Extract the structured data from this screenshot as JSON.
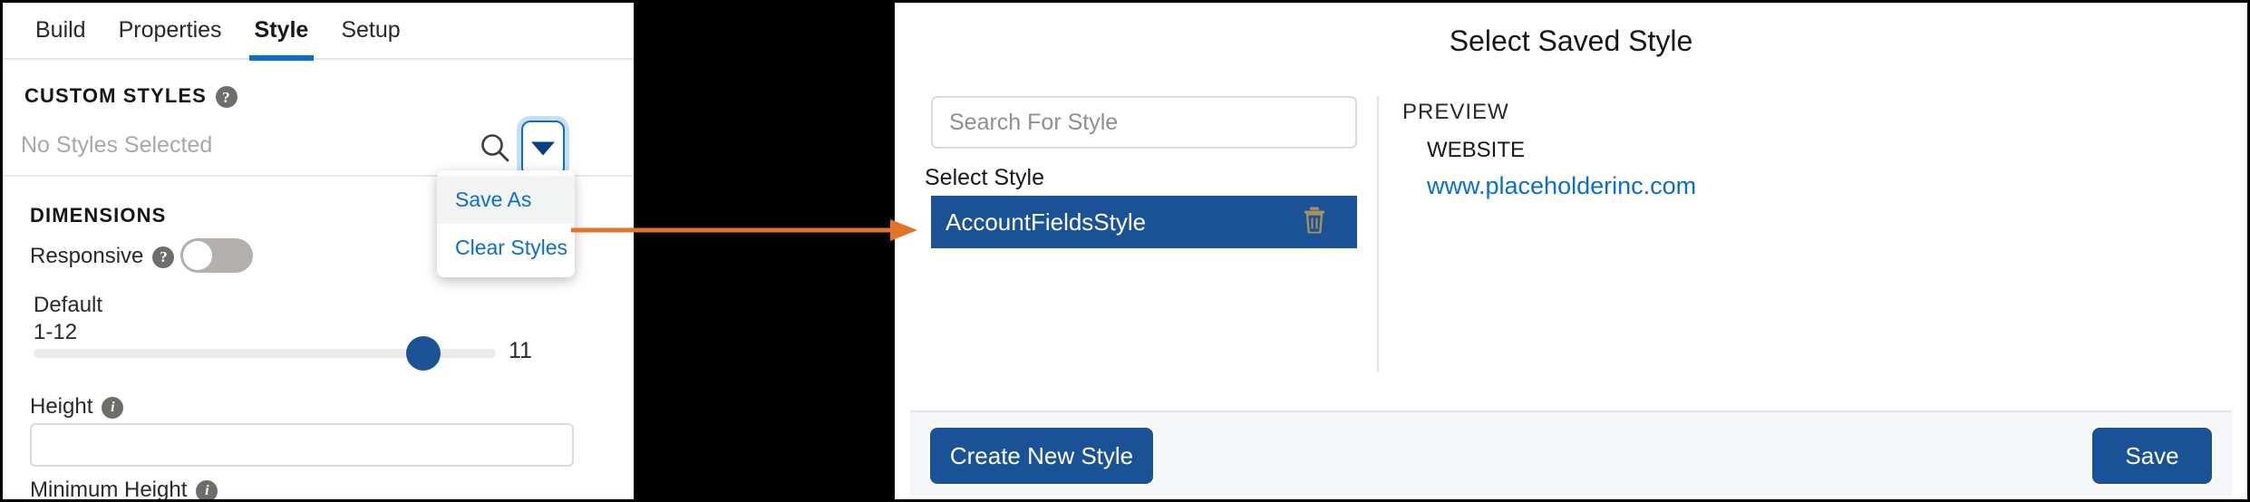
{
  "left_panel": {
    "tabs": [
      {
        "label": "Build",
        "active": false
      },
      {
        "label": "Properties",
        "active": false
      },
      {
        "label": "Style",
        "active": true
      },
      {
        "label": "Setup",
        "active": false
      }
    ],
    "custom_styles": {
      "heading": "CUSTOM STYLES",
      "help_glyph": "?",
      "selected_text": "No Styles Selected",
      "search_icon": "search-icon",
      "dropdown_icon": "chevron-down-icon"
    },
    "style_menu": {
      "items": [
        {
          "label": "Save As",
          "hovered": true
        },
        {
          "label": "Clear Styles",
          "hovered": false
        }
      ]
    },
    "dimensions": {
      "heading": "DIMENSIONS",
      "responsive_label": "Responsive",
      "responsive_help_glyph": "?",
      "responsive_on": false,
      "default_label": "Default",
      "range_label": "1-12",
      "slider_value": "11",
      "slider_min": 1,
      "slider_max": 12,
      "height_label": "Height",
      "height_help_glyph": "i",
      "height_value": "",
      "min_height_label": "Minimum Height",
      "min_height_help_glyph": "i"
    }
  },
  "modal": {
    "title": "Select Saved Style",
    "search": {
      "placeholder": "Search For Style",
      "value": ""
    },
    "select_style_label": "Select Style",
    "styles": [
      {
        "name": "AccountFieldsStyle",
        "selected": true,
        "delete_icon": "trash-icon"
      }
    ],
    "preview": {
      "heading": "PREVIEW",
      "field_label": "WEBSITE",
      "field_value": "www.placeholderinc.com"
    },
    "footer": {
      "create_label": "Create New Style",
      "save_label": "Save"
    }
  },
  "annotation": {
    "arrow_color": "#e2742a",
    "arrow_name": "callout-arrow"
  },
  "colors": {
    "accent_blue": "#0b6ecb",
    "selected_blue": "#1b5297",
    "arrow_orange": "#e2742a"
  }
}
